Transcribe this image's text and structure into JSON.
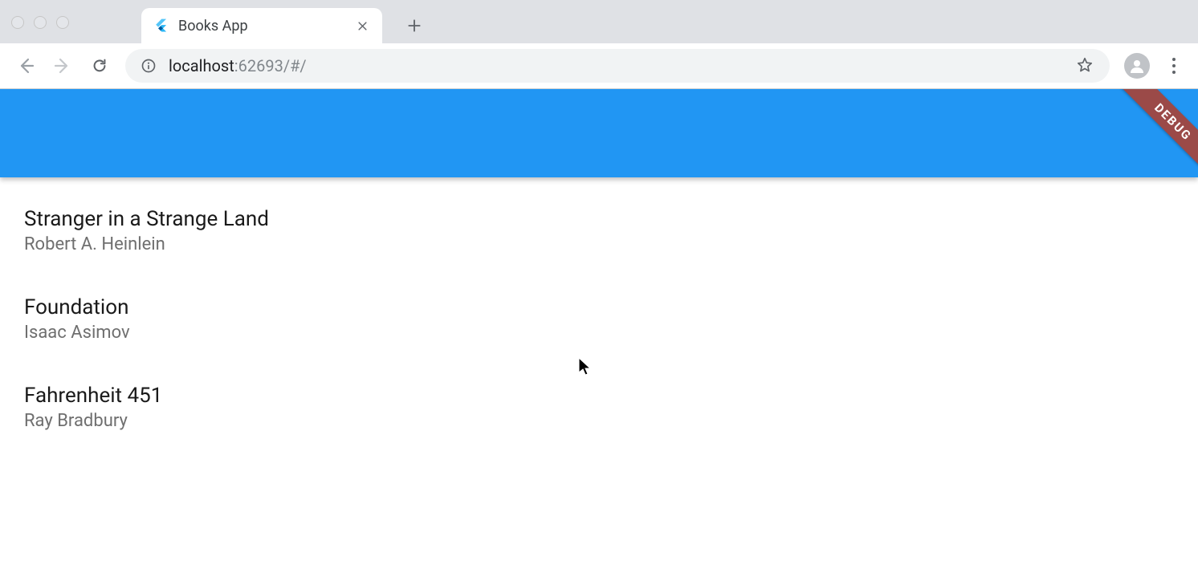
{
  "browser": {
    "tab": {
      "title": "Books App",
      "favicon": "flutter-icon"
    },
    "url": {
      "host": "localhost",
      "port_path": ":62693/#/"
    }
  },
  "app": {
    "debug_banner_label": "DEBUG",
    "books": [
      {
        "title": "Stranger in a Strange Land",
        "author": "Robert A. Heinlein"
      },
      {
        "title": "Foundation",
        "author": "Isaac Asimov"
      },
      {
        "title": "Fahrenheit 451",
        "author": "Ray Bradbury"
      }
    ]
  },
  "colors": {
    "app_bar": "#2196f3",
    "debug_banner": "#9b4a48"
  }
}
